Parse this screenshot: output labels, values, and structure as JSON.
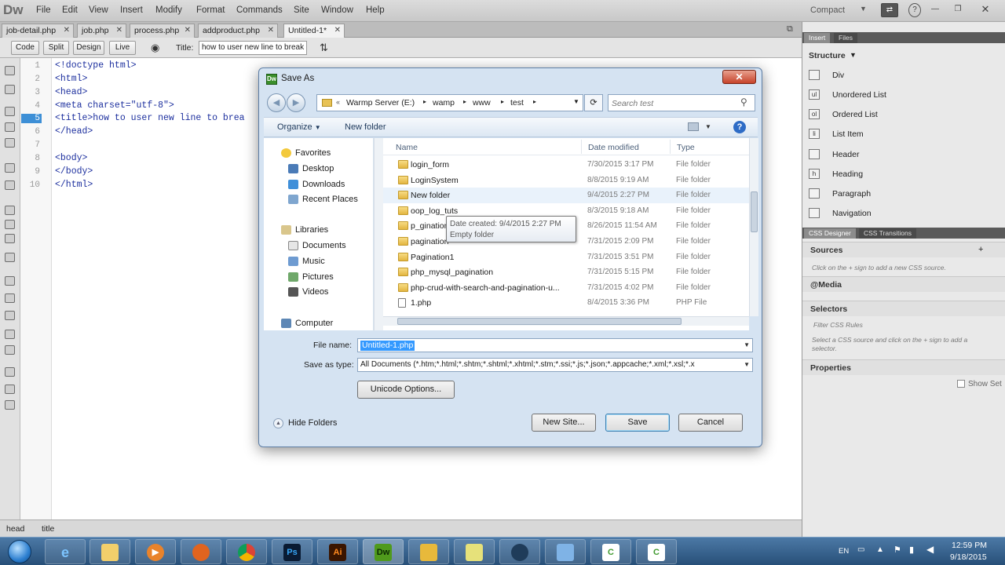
{
  "app": {
    "logo": "Dw",
    "menus": [
      "File",
      "Edit",
      "View",
      "Insert",
      "Modify",
      "Format",
      "Commands",
      "Site",
      "Window",
      "Help"
    ],
    "workspace": "Compact"
  },
  "doc_tabs": [
    "job-detail.php",
    "job.php",
    "process.php",
    "addproduct.php",
    "Untitled-1*"
  ],
  "toolbar": {
    "code": "Code",
    "split": "Split",
    "design": "Design",
    "live": "Live",
    "title_label": "Title:",
    "title_value": "how to user new line to break"
  },
  "editor": {
    "line_numbers": [
      "1",
      "2",
      "3",
      "4",
      "5",
      "6",
      "7",
      "8",
      "9",
      "10"
    ],
    "current_line": "5",
    "lines": [
      "<!doctype html>",
      "<html>",
      "<head>",
      "<meta charset=\"utf-8\">",
      "<title>how to user new line to brea",
      "</head>",
      "",
      "<body>",
      "</body>",
      "</html>"
    ]
  },
  "status_bar": {
    "crumbs": [
      "head",
      "title"
    ]
  },
  "right_panel": {
    "insert_tab": "Insert",
    "files_tab": "Files",
    "category": "Structure",
    "items": [
      {
        "icon": "div",
        "label": "Div"
      },
      {
        "icon": "ul",
        "label": "Unordered List"
      },
      {
        "icon": "ol",
        "label": "Ordered List"
      },
      {
        "icon": "li",
        "label": "List Item"
      },
      {
        "icon": "hdr",
        "label": "Header"
      },
      {
        "icon": "h",
        "label": "Heading"
      },
      {
        "icon": "p",
        "label": "Paragraph"
      },
      {
        "icon": "nav",
        "label": "Navigation"
      }
    ],
    "css_designer_tab": "CSS Designer",
    "css_transitions_tab": "CSS Transitions",
    "sources": "Sources",
    "sources_hint": "Click on the + sign to add a new CSS source.",
    "media": "@Media",
    "selectors": "Selectors",
    "filter_placeholder": "Filter CSS Rules",
    "selectors_hint": "Select a CSS source and click on the + sign to add a selector.",
    "properties": "Properties",
    "show_set": "Show Set"
  },
  "dialog": {
    "title": "Save As",
    "address": [
      "Warmp Server (E:)",
      "wamp",
      "www",
      "test"
    ],
    "search_placeholder": "Search test",
    "organize": "Organize",
    "new_folder_cmd": "New folder",
    "nav": {
      "favorites": "Favorites",
      "desktop": "Desktop",
      "downloads": "Downloads",
      "recent": "Recent Places",
      "libraries": "Libraries",
      "documents": "Documents",
      "music": "Music",
      "pictures": "Pictures",
      "videos": "Videos",
      "computer": "Computer"
    },
    "columns": {
      "name": "Name",
      "date": "Date modified",
      "type": "Type"
    },
    "files": [
      {
        "name": "login_form",
        "date": "7/30/2015 3:17 PM",
        "type": "File folder",
        "kind": "folder"
      },
      {
        "name": "LoginSystem",
        "date": "8/8/2015 9:19 AM",
        "type": "File folder",
        "kind": "folder"
      },
      {
        "name": "New folder",
        "date": "9/4/2015 2:27 PM",
        "type": "File folder",
        "kind": "folder"
      },
      {
        "name": "oop_log_tuts",
        "date": "8/3/2015 9:18 AM",
        "type": "File folder",
        "kind": "folder"
      },
      {
        "name": "p_gination",
        "date": "8/26/2015 11:54 AM",
        "type": "File folder",
        "kind": "folder"
      },
      {
        "name": "pagination",
        "date": "7/31/2015 2:09 PM",
        "type": "File folder",
        "kind": "folder"
      },
      {
        "name": "Pagination1",
        "date": "7/31/2015 3:51 PM",
        "type": "File folder",
        "kind": "folder"
      },
      {
        "name": "php_mysql_pagination",
        "date": "7/31/2015 5:15 PM",
        "type": "File folder",
        "kind": "folder"
      },
      {
        "name": "php-crud-with-search-and-pagination-u...",
        "date": "7/31/2015 4:02 PM",
        "type": "File folder",
        "kind": "folder"
      },
      {
        "name": "1.php",
        "date": "8/4/2015 3:36 PM",
        "type": "PHP File",
        "kind": "doc"
      }
    ],
    "tooltip": {
      "line1": "Date created: 9/4/2015 2:27 PM",
      "line2": "Empty folder"
    },
    "file_name_label": "File name:",
    "file_name_value": "Untitled-1.php",
    "save_type_label": "Save as type:",
    "save_type_value": "All Documents (*.htm;*.html;*.shtm;*.shtml;*.xhtml;*.stm;*.ssi;*.js;*.json;*.appcache;*.xml;*.xsl;*.x",
    "unicode_options": "Unicode Options...",
    "hide_folders": "Hide Folders",
    "new_site": "New Site...",
    "save": "Save",
    "cancel": "Cancel"
  },
  "taskbar": {
    "apps": [
      "internet-explorer",
      "file-explorer",
      "media-player",
      "firefox",
      "chrome",
      "photoshop",
      "illustrator",
      "dreamweaver",
      "file-manager",
      "sticky-notes",
      "network",
      "remote-desktop",
      "camtasia",
      "camtasia-recorder"
    ],
    "ps": "Ps",
    "ai": "Ai",
    "dw": "Dw",
    "lang": "EN",
    "time": "12:59 PM",
    "date": "9/18/2015"
  }
}
